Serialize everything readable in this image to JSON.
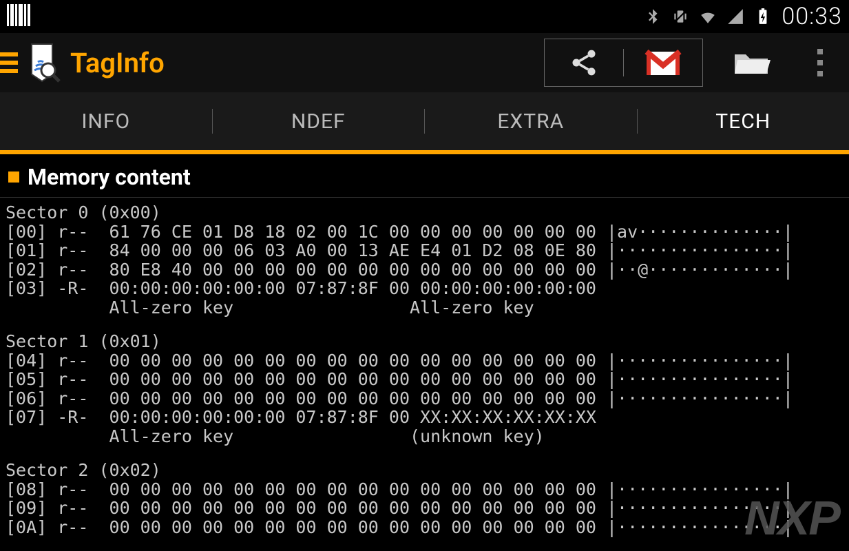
{
  "statusbar": {
    "time": "00:33",
    "icons": [
      "barcode",
      "bluetooth",
      "vibrate",
      "wifi",
      "signal",
      "battery-charging"
    ]
  },
  "actionbar": {
    "app_title": "TagInfo",
    "actions": [
      "share",
      "gmail",
      "folder",
      "overflow"
    ]
  },
  "tabs": {
    "items": [
      "INFO",
      "NDEF",
      "EXTRA",
      "TECH"
    ],
    "active_index": 3
  },
  "section": {
    "title": "Memory content"
  },
  "watermark": "NXP",
  "memory": {
    "sectors": [
      {
        "label": "Sector 0 (0x00)",
        "rows": [
          {
            "idx": "[00]",
            "perm": "r--",
            "bytes": "61 76 CE 01 D8 18 02 00 1C 00 00 00 00 00 00 00",
            "ascii": "|av··············|"
          },
          {
            "idx": "[01]",
            "perm": "r--",
            "bytes": "84 00 00 00 06 03 A0 00 13 AE E4 01 D2 08 0E 80",
            "ascii": "|················|"
          },
          {
            "idx": "[02]",
            "perm": "r--",
            "bytes": "80 E8 40 00 00 00 00 00 00 00 00 00 00 00 00 00",
            "ascii": "|··@·············|"
          },
          {
            "idx": "[03]",
            "perm": "-R-",
            "bytes": "00:00:00:00:00:00 07:87:8F 00 00:00:00:00:00:00",
            "ascii": ""
          }
        ],
        "trailer_note": "          All-zero key                 All-zero key"
      },
      {
        "label": "Sector 1 (0x01)",
        "rows": [
          {
            "idx": "[04]",
            "perm": "r--",
            "bytes": "00 00 00 00 00 00 00 00 00 00 00 00 00 00 00 00",
            "ascii": "|················|"
          },
          {
            "idx": "[05]",
            "perm": "r--",
            "bytes": "00 00 00 00 00 00 00 00 00 00 00 00 00 00 00 00",
            "ascii": "|················|"
          },
          {
            "idx": "[06]",
            "perm": "r--",
            "bytes": "00 00 00 00 00 00 00 00 00 00 00 00 00 00 00 00",
            "ascii": "|················|"
          },
          {
            "idx": "[07]",
            "perm": "-R-",
            "bytes": "00:00:00:00:00:00 07:87:8F 00 XX:XX:XX:XX:XX:XX",
            "ascii": ""
          }
        ],
        "trailer_note": "          All-zero key                 (unknown key)"
      },
      {
        "label": "Sector 2 (0x02)",
        "rows": [
          {
            "idx": "[08]",
            "perm": "r--",
            "bytes": "00 00 00 00 00 00 00 00 00 00 00 00 00 00 00 00",
            "ascii": "|················|"
          },
          {
            "idx": "[09]",
            "perm": "r--",
            "bytes": "00 00 00 00 00 00 00 00 00 00 00 00 00 00 00 00",
            "ascii": "|················|"
          },
          {
            "idx": "[0A]",
            "perm": "r--",
            "bytes": "00 00 00 00 00 00 00 00 00 00 00 00 00 00 00 00",
            "ascii": "|················|"
          }
        ],
        "trailer_note": ""
      }
    ]
  }
}
